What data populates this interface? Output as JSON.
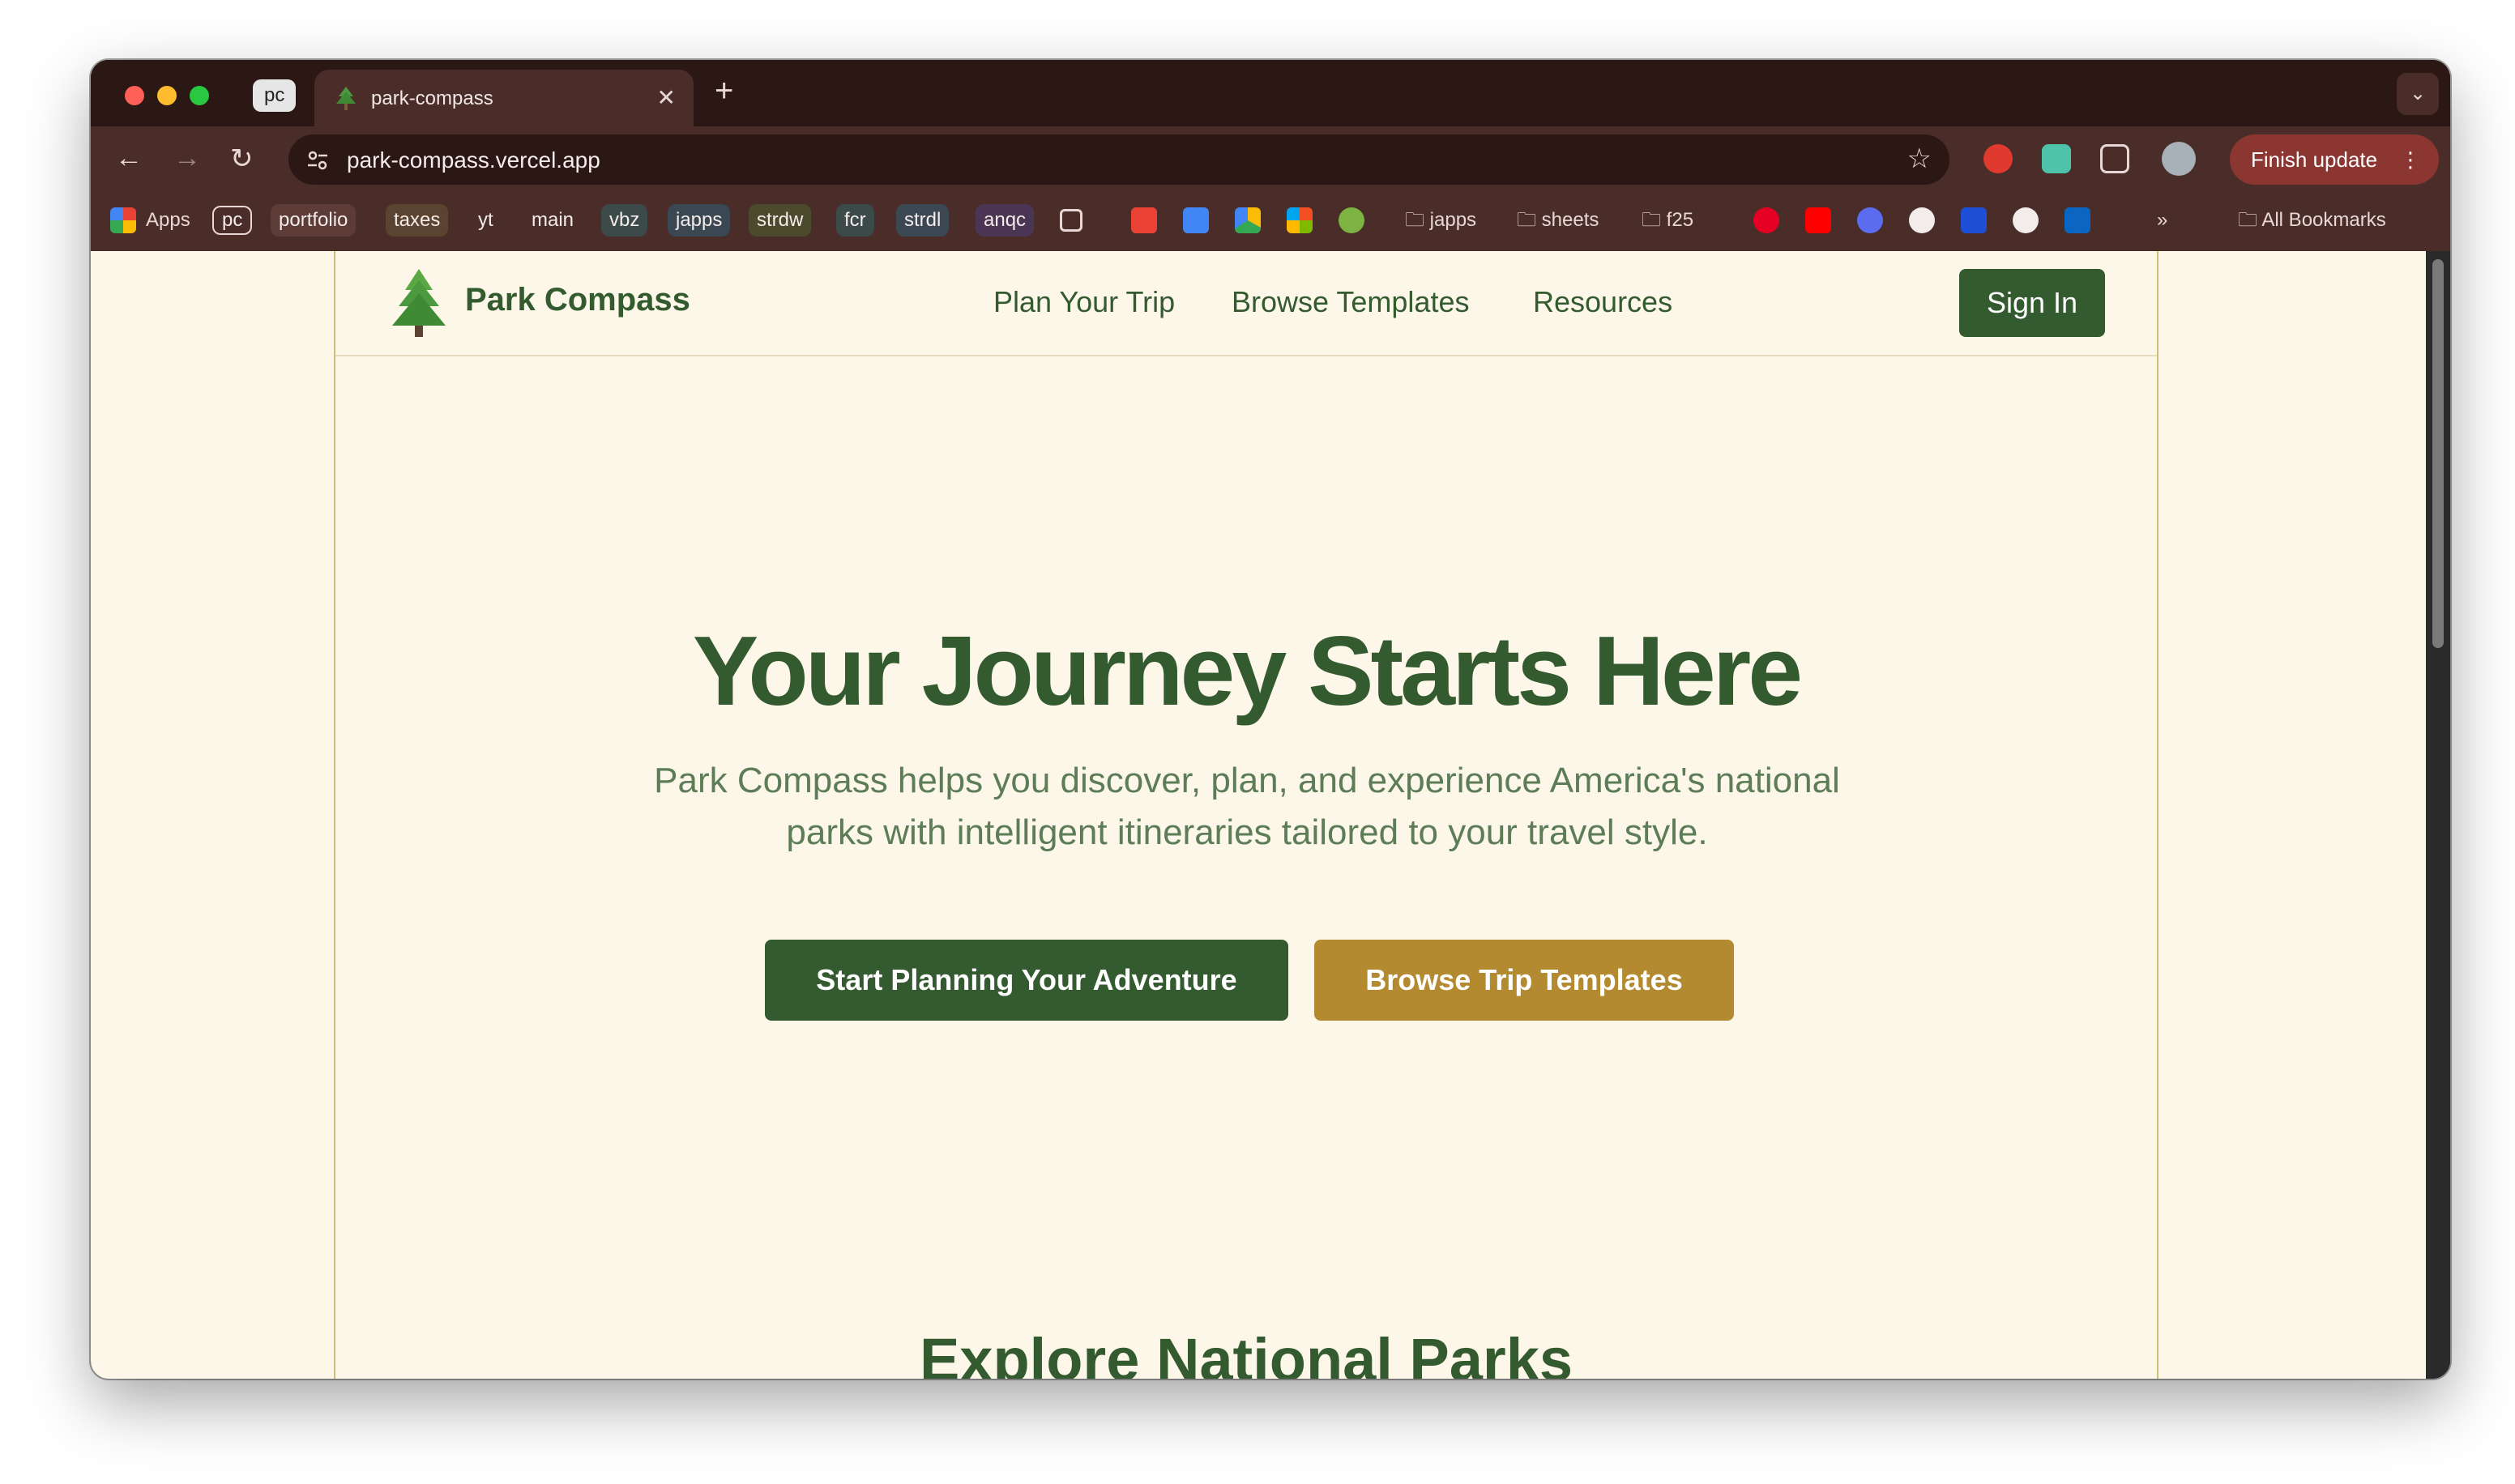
{
  "browser": {
    "tab_group_label": "pc",
    "tab_title": "park-compass",
    "url": "park-compass.vercel.app",
    "finish_update_label": "Finish update",
    "bookmarks": {
      "apps": "Apps",
      "chips": [
        "pc",
        "portfolio",
        "taxes",
        "yt",
        "main",
        "vbz",
        "japps",
        "strdw",
        "fcr",
        "strdl",
        "anqc"
      ],
      "folders": [
        "japps",
        "sheets",
        "f25"
      ],
      "all_bookmarks": "All Bookmarks"
    }
  },
  "site": {
    "brand": "Park Compass",
    "nav": [
      "Plan Your Trip",
      "Browse Templates",
      "Resources"
    ],
    "signin_label": "Sign In",
    "hero_title": "Your Journey Starts Here",
    "hero_subtitle": "Park Compass helps you discover, plan, and experience America's national parks with intelligent itineraries tailored to your travel style.",
    "cta_primary": "Start Planning Your Adventure",
    "cta_secondary": "Browse Trip Templates",
    "section_title": "Explore National Parks"
  },
  "colors": {
    "brand_green": "#345a30",
    "accent_gold": "#b38a2f",
    "page_background": "#fdf7e9",
    "browser_frame": "#4a2d29"
  }
}
